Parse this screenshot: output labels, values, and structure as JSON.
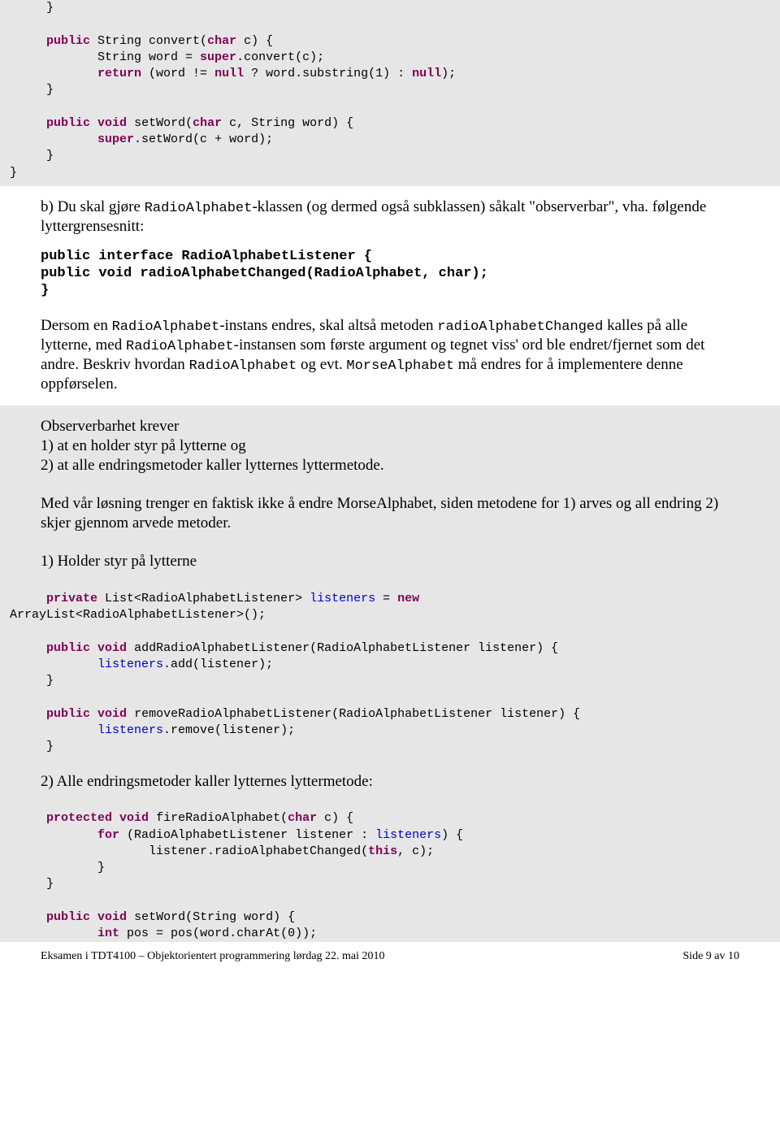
{
  "code1_l1": "     }",
  "code1_l2": "",
  "code1_l3a": "     ",
  "code1_l3_kw1": "public",
  "code1_l3b": " String convert(",
  "code1_l3_kw2": "char",
  "code1_l3c": " c) {",
  "code1_l4a": "            String word = ",
  "code1_l4_kw1": "super",
  "code1_l4b": ".convert(c);",
  "code1_l5a": "            ",
  "code1_l5_kw1": "return",
  "code1_l5b": " (word != ",
  "code1_l5_kw2": "null",
  "code1_l5c": " ? word.substring(1) : ",
  "code1_l5_kw3": "null",
  "code1_l5d": ");",
  "code1_l6": "     }",
  "code1_l7": "",
  "code1_l8a": "     ",
  "code1_l8_kw1": "public",
  "code1_l8b": " ",
  "code1_l8_kw2": "void",
  "code1_l8c": " setWord(",
  "code1_l8_kw3": "char",
  "code1_l8d": " c, String word) {",
  "code1_l9a": "            ",
  "code1_l9_kw1": "super",
  "code1_l9b": ".setWord(c + word);",
  "code1_l10": "     }",
  "code1_l11": "}",
  "p1a": "b) Du skal gjøre ",
  "p1m1": "RadioAlphabet",
  "p1b": "-klassen (og dermed også subklassen) såkalt \"observerbar\", vha. følgende lyttergrensesnitt:",
  "iface_l1": "public interface RadioAlphabetListener {",
  "iface_l2": "    public void radioAlphabetChanged(RadioAlphabet, char);",
  "iface_l3": "}",
  "p2a": "Dersom en ",
  "p2m1": "RadioAlphabet",
  "p2b": "-instans endres, skal altså metoden ",
  "p2m2": "radioAlphabetChanged",
  "p2c": " kalles på alle lytterne, med ",
  "p2m3": "RadioAlphabet",
  "p2d": "-instansen som første argument og tegnet viss' ord ble endret/fjernet som det andre. Beskriv hvordan ",
  "p2m4": "RadioAlphabet",
  "p2e": " og evt. ",
  "p2m5": "MorseAlphabet",
  "p2f": " må endres for å implementere denne oppførselen.",
  "p3_l1": "Observerbarhet krever",
  "p3_l2": "1) at en holder styr på lytterne og",
  "p3_l3": "2) at alle endringsmetoder kaller lytternes lyttermetode.",
  "p3_l4": "Med vår løsning trenger en faktisk ikke å endre MorseAlphabet, siden metodene for 1) arves og all endring 2) skjer gjennom arvede metoder.",
  "p3_l5": "1) Holder styr på lytterne",
  "code2_l1a": "     ",
  "code2_l1_kw1": "private",
  "code2_l1b": " List<RadioAlphabetListener> ",
  "code2_l1_fld1": "listeners",
  "code2_l1c": " = ",
  "code2_l1_kw2": "new",
  "code2_l2": "ArrayList<RadioAlphabetListener>();",
  "code2_l3": "",
  "code2_l4a": "     ",
  "code2_l4_kw1": "public",
  "code2_l4b": " ",
  "code2_l4_kw2": "void",
  "code2_l4c": " addRadioAlphabetListener(RadioAlphabetListener listener) {",
  "code2_l5a": "            ",
  "code2_l5_fld1": "listeners",
  "code2_l5b": ".add(listener);",
  "code2_l6": "     }",
  "code2_l7": "",
  "code2_l8a": "     ",
  "code2_l8_kw1": "public",
  "code2_l8b": " ",
  "code2_l8_kw2": "void",
  "code2_l8c": " removeRadioAlphabetListener(RadioAlphabetListener listener) {",
  "code2_l9a": "            ",
  "code2_l9_fld1": "listeners",
  "code2_l9b": ".remove(listener);",
  "code2_l10": "     }",
  "p4": "2) Alle endringsmetoder kaller lytternes lyttermetode:",
  "code3_l1a": "     ",
  "code3_l1_kw1": "protected",
  "code3_l1b": " ",
  "code3_l1_kw2": "void",
  "code3_l1c": " fireRadioAlphabet(",
  "code3_l1_kw3": "char",
  "code3_l1d": " c) {",
  "code3_l2a": "            ",
  "code3_l2_kw1": "for",
  "code3_l2b": " (RadioAlphabetListener listener : ",
  "code3_l2_fld1": "listeners",
  "code3_l2c": ") {",
  "code3_l3a": "                   listener.radioAlphabetChanged(",
  "code3_l3_kw1": "this",
  "code3_l3b": ", c);",
  "code3_l4": "            }",
  "code3_l5": "     }",
  "code3_l6": "",
  "code3_l7a": "     ",
  "code3_l7_kw1": "public",
  "code3_l7b": " ",
  "code3_l7_kw2": "void",
  "code3_l7c": " setWord(String word) {",
  "code3_l8a": "            ",
  "code3_l8_kw1": "int",
  "code3_l8b": " pos = pos(word.charAt(0));",
  "footer_left": "Eksamen i TDT4100 – Objektorientert programmering lørdag 22. mai 2010",
  "footer_right": "Side 9 av 10"
}
